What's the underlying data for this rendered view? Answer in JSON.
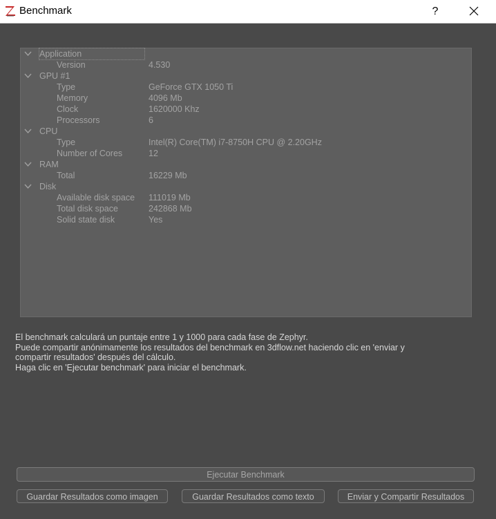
{
  "window": {
    "title": "Benchmark",
    "help_label": "?"
  },
  "tree": [
    {
      "label": "Application",
      "items": [
        {
          "key": "Version",
          "value": "4.530"
        }
      ]
    },
    {
      "label": "GPU #1",
      "items": [
        {
          "key": "Type",
          "value": "GeForce GTX 1050 Ti"
        },
        {
          "key": "Memory",
          "value": "4096 Mb"
        },
        {
          "key": "Clock",
          "value": "1620000 Khz"
        },
        {
          "key": "Processors",
          "value": "6"
        }
      ]
    },
    {
      "label": "CPU",
      "items": [
        {
          "key": "Type",
          "value": "Intel(R) Core(TM) i7-8750H CPU @ 2.20GHz"
        },
        {
          "key": "Number of Cores",
          "value": "12"
        }
      ]
    },
    {
      "label": "RAM",
      "items": [
        {
          "key": "Total",
          "value": "16229 Mb"
        }
      ]
    },
    {
      "label": "Disk",
      "items": [
        {
          "key": "Available disk space",
          "value": "111019 Mb"
        },
        {
          "key": "Total disk space",
          "value": "242868 Mb"
        },
        {
          "key": "Solid state disk",
          "value": "Yes"
        }
      ]
    }
  ],
  "description": [
    "El benchmark calculará un puntaje entre 1 y 1000 para cada fase de Zephyr.",
    "Puede compartir anónimamente los resultados del benchmark en 3dflow.net haciendo clic en 'enviar y",
    "compartir resultados' después del cálculo.",
    "Haga clic en 'Ejecutar benchmark' para iniciar el benchmark."
  ],
  "buttons": {
    "run": "Ejecutar Benchmark",
    "save_image": "Guardar Resultados como imagen",
    "save_text": "Guardar Resultados como texto",
    "send_share": "Enviar y Compartir Resultados"
  }
}
